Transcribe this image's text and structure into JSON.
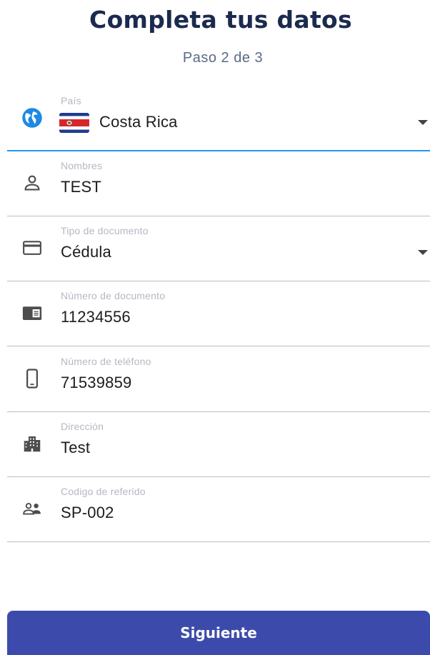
{
  "header": {
    "title": "Completa tus datos",
    "step": "Paso 2 de 3"
  },
  "form": {
    "fields": [
      {
        "label": "País",
        "value": "Costa Rica",
        "icon": "globe-icon",
        "dropdown": true,
        "flag": "costa-rica-flag",
        "active": true
      },
      {
        "label": "Nombres",
        "value": "TEST",
        "icon": "person-icon"
      },
      {
        "label": "Tipo de documento",
        "value": "Cédula",
        "icon": "credit-card-icon",
        "dropdown": true
      },
      {
        "label": "Número de documento",
        "value": "11234556",
        "icon": "id-card-icon"
      },
      {
        "label": "Número de teléfono",
        "value": "71539859",
        "icon": "phone-icon"
      },
      {
        "label": "Dirección",
        "value": "Test",
        "icon": "building-icon"
      },
      {
        "label": "Codigo de referido",
        "value": "SP-002",
        "icon": "people-icon"
      }
    ]
  },
  "actions": {
    "next_label": "Siguiente"
  },
  "colors": {
    "title": "#1b2a4e",
    "accent": "#2196f3",
    "button": "#3c4bab",
    "label": "#b5b8c2"
  }
}
